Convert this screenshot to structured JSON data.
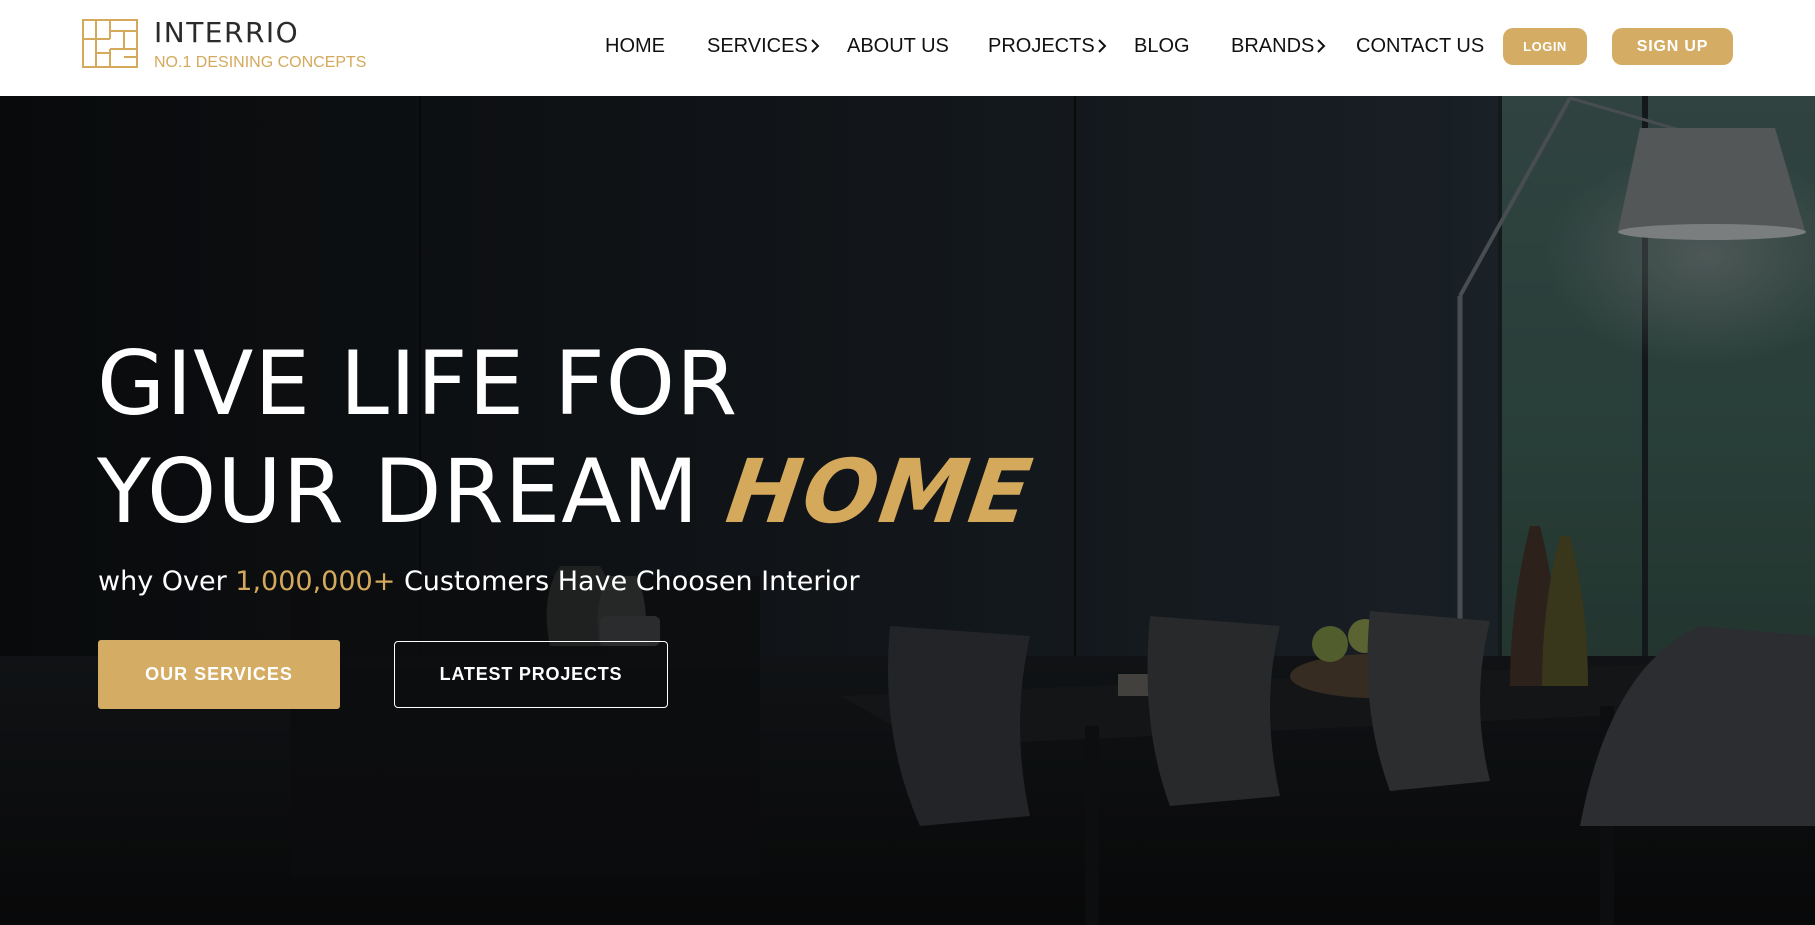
{
  "brand": {
    "name": "INTERRIO",
    "tagline": "NO.1 DESINING CONCEPTS",
    "logo_icon": "maze-grid-logo"
  },
  "nav": {
    "items": [
      {
        "label": "HOME"
      },
      {
        "label": "SERVICES",
        "icon": "chevron-right-icon"
      },
      {
        "label": "ABOUT US"
      },
      {
        "label": "PROJECTS",
        "icon": "chevron-right-icon"
      },
      {
        "label": "BLOG"
      },
      {
        "label": "BRANDS",
        "icon": "chevron-right-icon"
      },
      {
        "label": "CONTACT US"
      }
    ],
    "login_label": "LOGIN",
    "signup_label": "SIGN UP"
  },
  "hero": {
    "title_line1": "GIVE LIFE FOR",
    "title_line2": "YOUR DREAM",
    "title_accent": "HOME",
    "subtitle_prefix": "why Over",
    "subtitle_highlight": "1,000,000+",
    "subtitle_suffix": "Customers Have Choosen Interior",
    "primary_cta": "OUR SERVICES",
    "secondary_cta": "LATEST PROJECTS"
  },
  "colors": {
    "accent": "#d4ac64",
    "header_bg": "#ffffff",
    "hero_overlay": "#0f1316"
  }
}
